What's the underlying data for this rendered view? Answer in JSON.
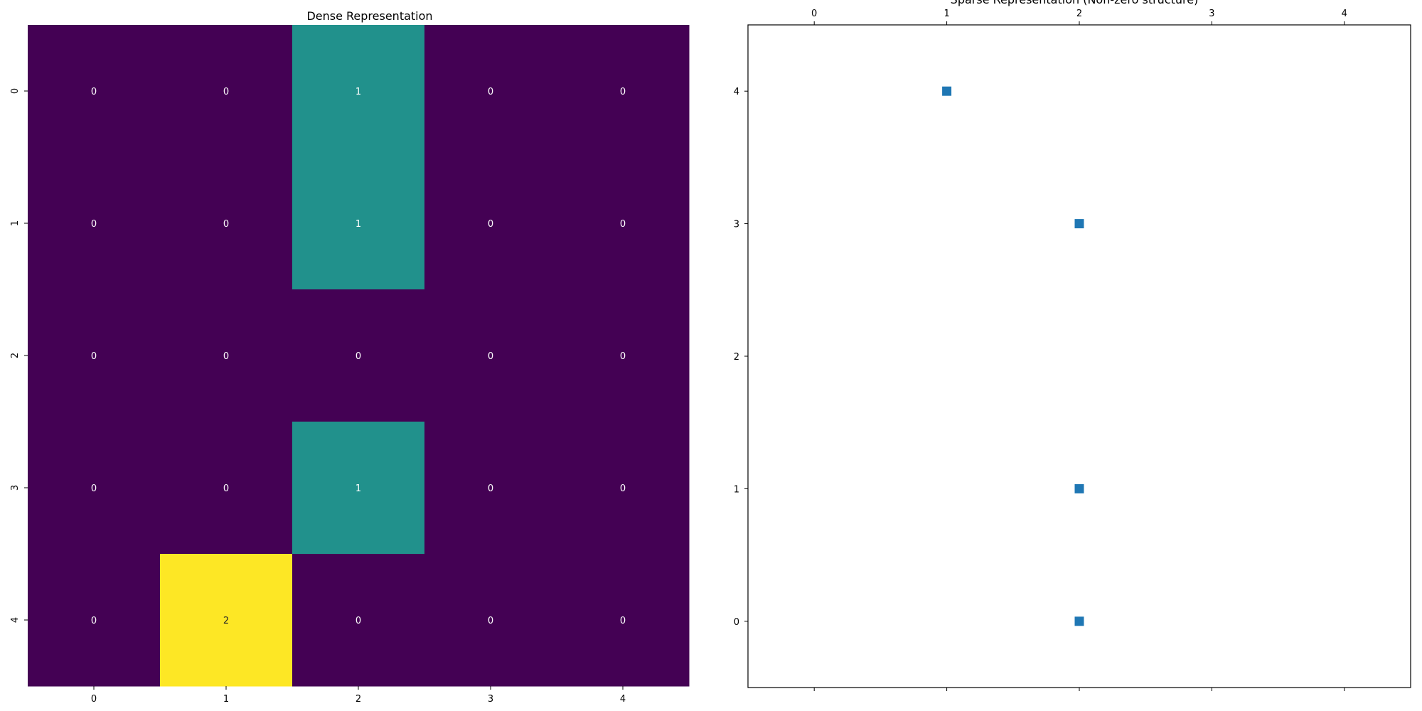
{
  "chart_data": [
    {
      "type": "heatmap",
      "title": "Dense Representation",
      "x_ticks": [
        "0",
        "1",
        "2",
        "3",
        "4"
      ],
      "y_ticks": [
        "0",
        "1",
        "2",
        "3",
        "4"
      ],
      "matrix": [
        [
          0,
          0,
          1,
          0,
          0
        ],
        [
          0,
          0,
          1,
          0,
          0
        ],
        [
          0,
          0,
          0,
          0,
          0
        ],
        [
          0,
          0,
          1,
          0,
          0
        ],
        [
          0,
          2,
          0,
          0,
          0
        ]
      ],
      "colormap": "viridis",
      "vmin": 0,
      "vmax": 2,
      "annotations": true,
      "colors": {
        "0": "#440154",
        "1": "#21918c",
        "2": "#fde725"
      },
      "annotation_colors": {
        "dark_cell": "#ffffff",
        "light_cell": "#262626"
      }
    },
    {
      "type": "scatter",
      "title": "Sparse Representation (Non-zero structure)",
      "x_ticks": [
        "0",
        "1",
        "2",
        "3",
        "4"
      ],
      "y_ticks": [
        "0",
        "1",
        "2",
        "3",
        "4"
      ],
      "x_axis_position": "top",
      "y_inverted": true,
      "xlim": [
        -0.5,
        4.5
      ],
      "ylim": [
        4.5,
        -0.5
      ],
      "points": [
        {
          "x": 2,
          "y": 0
        },
        {
          "x": 2,
          "y": 1
        },
        {
          "x": 2,
          "y": 3
        },
        {
          "x": 1,
          "y": 4
        }
      ],
      "marker": "square",
      "marker_color": "#1f77b4"
    }
  ]
}
